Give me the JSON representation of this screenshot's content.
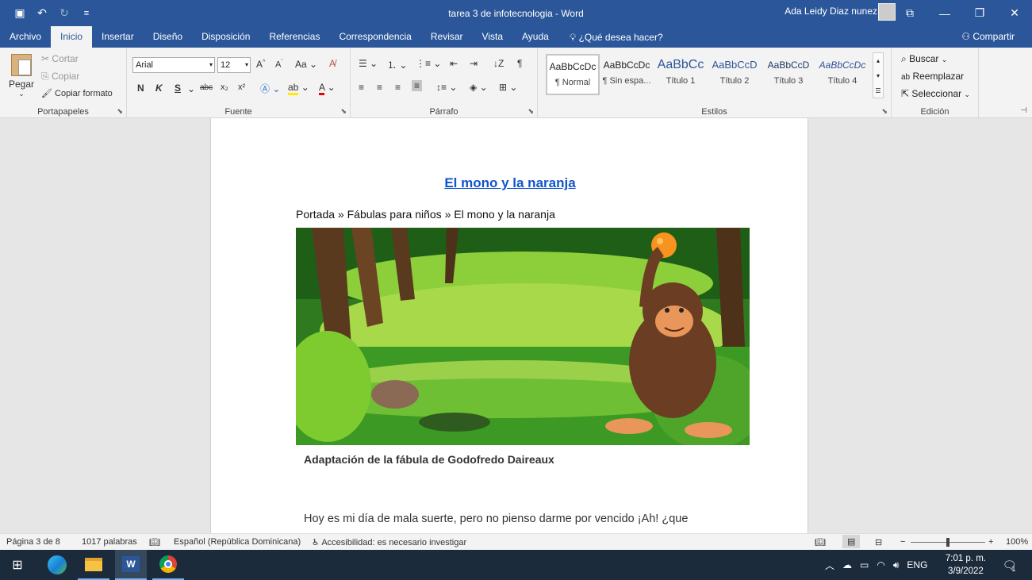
{
  "window": {
    "doc_title": "tarea 3 de infotecnologia  -  Word",
    "user_name": "Ada Leidy Diaz nunez"
  },
  "menu": {
    "tabs": [
      "Archivo",
      "Inicio",
      "Insertar",
      "Diseño",
      "Disposición",
      "Referencias",
      "Correspondencia",
      "Revisar",
      "Vista",
      "Ayuda"
    ],
    "active_tab": "Inicio",
    "tell_me": "¿Qué desea hacer?",
    "share": "Compartir"
  },
  "ribbon": {
    "clipboard": {
      "label": "Portapapeles",
      "paste": "Pegar",
      "cut": "Cortar",
      "copy": "Copiar",
      "format_painter": "Copiar formato"
    },
    "font": {
      "label": "Fuente",
      "font_name": "Arial",
      "font_size": "12",
      "bold": "N",
      "italic": "K",
      "underline": "S"
    },
    "paragraph": {
      "label": "Párrafo"
    },
    "styles": {
      "label": "Estilos",
      "items": [
        {
          "sample": "AaBbCcDc",
          "name": "¶ Normal"
        },
        {
          "sample": "AaBbCcDc",
          "name": "¶ Sin espa..."
        },
        {
          "sample": "AaBbCc",
          "name": "Título 1"
        },
        {
          "sample": "AaBbCcD",
          "name": "Título 2"
        },
        {
          "sample": "AaBbCcD",
          "name": "Título 3"
        },
        {
          "sample": "AaBbCcDc",
          "name": "Título 4"
        }
      ]
    },
    "editing": {
      "label": "Edición",
      "find": "Buscar",
      "replace": "Reemplazar",
      "select": "Seleccionar"
    }
  },
  "document": {
    "heading": "El mono y la naranja",
    "breadcrumb": "Portada » Fábulas para niños » El mono y la naranja",
    "caption": "Adaptación de la fábula de Godofredo Daireaux",
    "body_line1": "Hoy es mi día de mala suerte, pero no pienso darme por vencido ¡Ah! ¿que"
  },
  "status": {
    "page": "Página 3 de 8",
    "words": "1017 palabras",
    "language": "Español (República Dominicana)",
    "accessibility": "Accesibilidad: es necesario investigar",
    "zoom": "100%"
  },
  "taskbar": {
    "lang": "ENG",
    "time": "7:01 p. m.",
    "date": "3/9/2022",
    "notif_count": "1"
  },
  "colors": {
    "word_blue": "#2b579a",
    "heading_link": "#1155cc"
  }
}
